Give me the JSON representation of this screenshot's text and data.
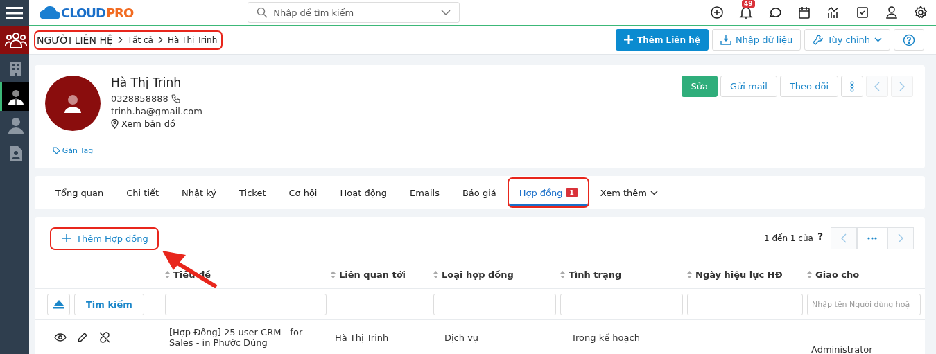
{
  "sidebar": {
    "items": [
      {
        "selected": false,
        "highlight": true
      },
      {
        "selected": false,
        "highlight": false
      },
      {
        "selected": true,
        "highlight": false
      },
      {
        "selected": false,
        "highlight": false
      },
      {
        "selected": false,
        "highlight": false
      }
    ]
  },
  "logo": {
    "part1": "CLOUD",
    "part2": "PRO"
  },
  "search": {
    "placeholder": "Nhập để tìm kiếm"
  },
  "notification_count": "49",
  "breadcrumb": {
    "items": [
      "NGƯỜI LIÊN HỆ",
      "Tất cả",
      "Hà Thị Trinh"
    ],
    "highlighted": true
  },
  "header_buttons": [
    {
      "label": "Thêm Liên hệ",
      "kind": "primary"
    },
    {
      "label": "Nhập dữ liệu",
      "kind": "outline"
    },
    {
      "label": "Tùy chỉnh",
      "kind": "dropdown"
    },
    {
      "kind": "icon"
    }
  ],
  "contact": {
    "name": "Hà Thị Trinh",
    "phone": "0328858888",
    "email": "trinh.ha@gmail.com",
    "map_link": "Xem bản đồ",
    "tag_link": "Gán Tag"
  },
  "contact_buttons": [
    {
      "label": "Sửa",
      "kind": "success"
    },
    {
      "label": "Gửi mail",
      "kind": "outline"
    },
    {
      "label": "Theo dõi",
      "kind": "outline"
    },
    {
      "kind": "more"
    },
    {
      "kind": "prev"
    },
    {
      "kind": "next"
    }
  ],
  "tabs": [
    {
      "label": "Tổng quan",
      "selected": false
    },
    {
      "label": "Chi tiết",
      "selected": false
    },
    {
      "label": "Nhật ký",
      "selected": false
    },
    {
      "label": "Ticket",
      "selected": false
    },
    {
      "label": "Cơ hội",
      "selected": false
    },
    {
      "label": "Hoạt động",
      "selected": false
    },
    {
      "label": "Emails",
      "selected": false
    },
    {
      "label": "Báo giá",
      "selected": false
    },
    {
      "label": "Hợp đồng",
      "selected": true,
      "badge": "1",
      "highlighted": true
    },
    {
      "label": "Xem thêm",
      "selected": false,
      "dropdown": true
    }
  ],
  "add_button": {
    "label": "Thêm Hợp đồng",
    "highlighted": true
  },
  "pagination": {
    "text": "1 đến 1 của",
    "help": "?"
  },
  "table": {
    "columns": [
      "Tiêu đề",
      "Liên quan tới",
      "Loại hợp đồng",
      "Tình trạng",
      "Ngày hiệu lực HĐ",
      "Giao cho"
    ],
    "filters": [
      {
        "kind": "input"
      },
      {
        "kind": "none"
      },
      {
        "kind": "input"
      },
      {
        "kind": "input"
      },
      {
        "kind": "input"
      },
      {
        "kind": "input",
        "placeholder": "Nhập tên Người dùng hoặ"
      }
    ],
    "search_button": "Tìm kiếm",
    "rows": [
      {
        "cells": [
          "[Hợp Đồng] 25 user CRM - for Sales - in Phước Dũng",
          "Hà Thị Trinh",
          "Dịch vụ",
          "Trong kế hoạch",
          "",
          "Administrator"
        ]
      }
    ]
  }
}
